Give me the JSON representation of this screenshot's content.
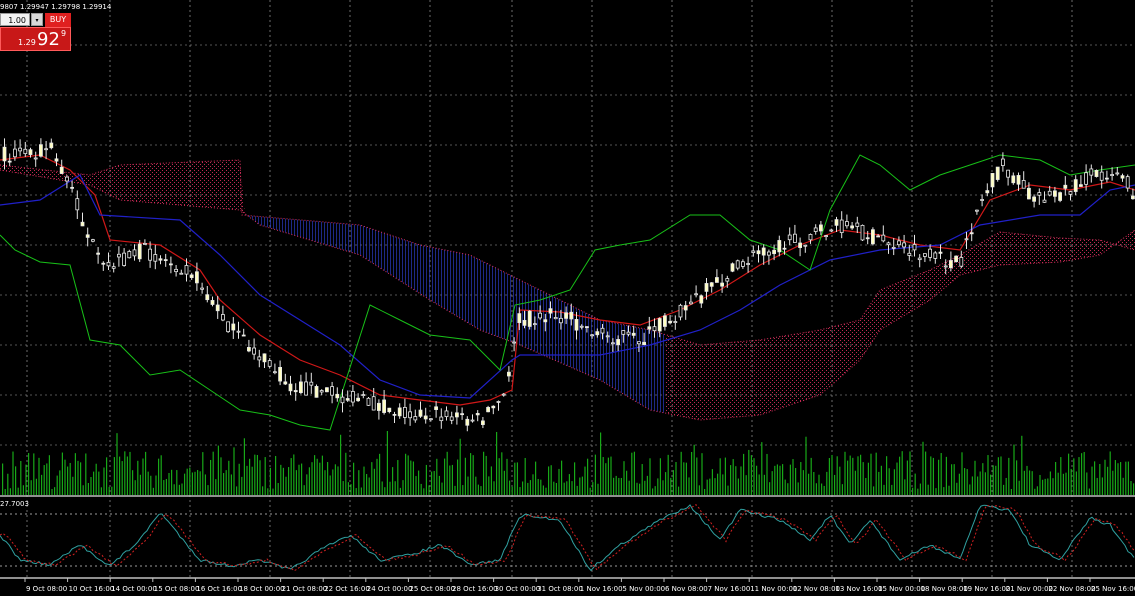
{
  "window": {
    "ohlc_text": "9807 1.29947 1.29798 1.29914"
  },
  "trade_panel": {
    "lot_value": "1.00",
    "lot_arrow": "▾",
    "buy_label": "BUY",
    "buy_price_prefix": "1.29",
    "buy_price_big": "92",
    "buy_price_sup": "9"
  },
  "oscillator": {
    "label": "27.7003"
  },
  "time_axis": {
    "labels": [
      "9 Oct 08:00",
      "10 Oct 16:00",
      "14 Oct 00:00",
      "15 Oct 08:00",
      "16 Oct 16:00",
      "18 Oct 00:00",
      "21 Oct 08:00",
      "22 Oct 16:00",
      "24 Oct 00:00",
      "25 Oct 08:00",
      "28 Oct 16:00",
      "30 Oct 00:00",
      "31 Oct 08:00",
      "1 Nov 16:00",
      "5 Nov 00:00",
      "6 Nov 08:00",
      "7 Nov 16:00",
      "11 Nov 00:00",
      "12 Nov 08:00",
      "13 Nov 16:00",
      "15 Nov 00:00",
      "18 Nov 08:00",
      "19 Nov 16:00",
      "21 Nov 00:00",
      "22 Nov 08:00",
      "25 Nov 16:00"
    ]
  },
  "colors": {
    "background": "#000000",
    "grid": "#9a9a9a",
    "candle_bull": "#ffffc0",
    "tenkan": "#d01818",
    "kijun": "#2020c8",
    "chikou": "#18c018",
    "kumo_bull": "#e03060",
    "kumo_bear": "#3040d0",
    "volume": "#18a818",
    "osc_main": "#30a0a0",
    "osc_signal": "#d02020"
  }
}
